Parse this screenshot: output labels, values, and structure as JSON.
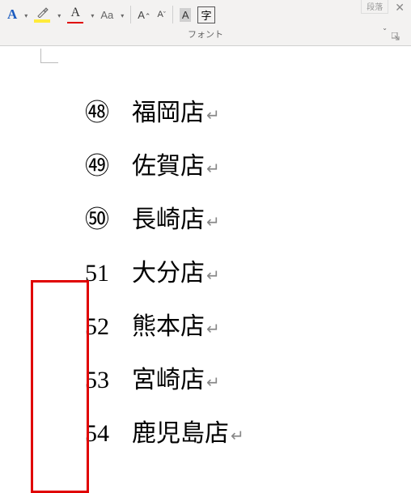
{
  "ribbon": {
    "group_label": "フォント",
    "right_panel_label": "段落",
    "buttons": {
      "font_color_bold": "A",
      "font_color": "A",
      "change_case": "Aa",
      "grow_font": "A",
      "grow_font_sup": "⌃",
      "shrink_font": "A",
      "shrink_font_sup": "ˇ",
      "highlight_bg": "A",
      "char_border": "字"
    }
  },
  "document": {
    "items": [
      {
        "num": "㊽",
        "text": "福岡店"
      },
      {
        "num": "㊾",
        "text": "佐賀店"
      },
      {
        "num": "㊿",
        "text": "長崎店"
      },
      {
        "num": "51",
        "text": "大分店"
      },
      {
        "num": "52",
        "text": "熊本店"
      },
      {
        "num": "53",
        "text": "宮崎店"
      },
      {
        "num": "54",
        "text": "鹿児島店"
      }
    ],
    "para_mark": "↵"
  }
}
